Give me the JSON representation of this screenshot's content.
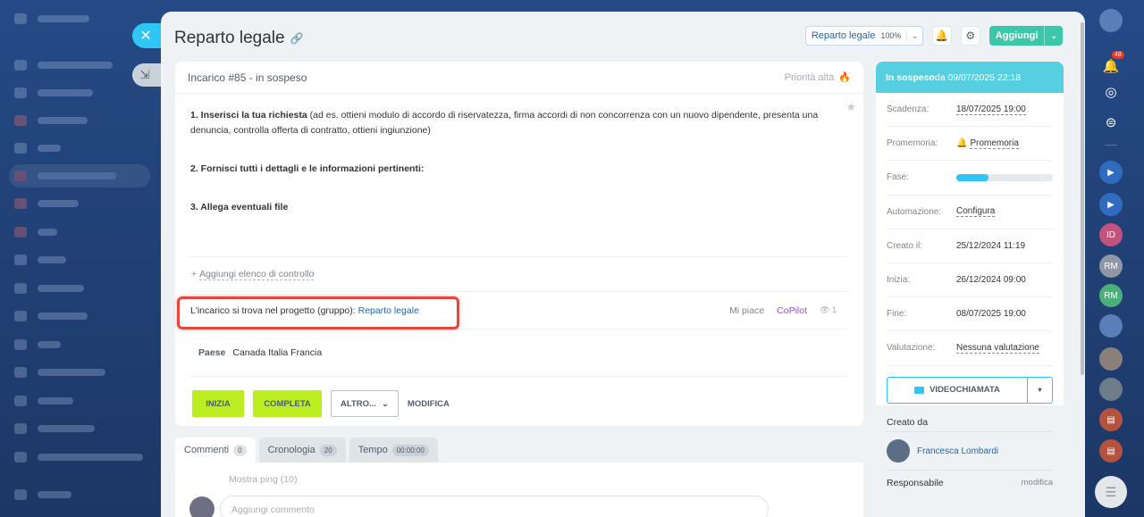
{
  "header": {
    "title": "Reparto legale",
    "project_label": "Reparto legale",
    "project_pct": "100%",
    "add_label": "Aggiungi"
  },
  "task": {
    "heading": "Incarico #85 - in sospeso",
    "priority": "Priorità alta",
    "desc": {
      "p1_bold": "1. Inserisci la tua richiesta",
      "p1_text": " (ad es. ottieni modulo di accordo di riservatezza, firma accordi di non concorrenza con un nuovo dipendente, presenta una denuncia, controlla offerta di contratto, ottieni ingiunzione)",
      "p2": "2. Fornisci tutti i dettagli e le informazioni pertinenti:",
      "p3": "3. Allega eventuali file"
    },
    "checklist": "Aggiungi elenco di controllo",
    "project_text": "L'incarico si trova nel progetto (gruppo):",
    "project_link": "Reparto legale",
    "like": "Mi piace",
    "copilot": "CoPilot",
    "views": "1",
    "country_key": "Paese",
    "country_val": "Canada Italia Francia",
    "buttons": {
      "start": "INIZIA",
      "complete": "COMPLETA",
      "more": "ALTRO...",
      "edit": "MODIFICA"
    }
  },
  "tabs": [
    {
      "label": "Commenti",
      "count": "0"
    },
    {
      "label": "Cronologia",
      "count": "20"
    },
    {
      "label": "Tempo",
      "count": "00:00:00"
    }
  ],
  "comments": {
    "ping": "Mostra ping (10)",
    "placeholder": "Aggiungi commento"
  },
  "sidebar": {
    "status_bold": "In sospeso",
    "status_rest": " da 09/07/2025 22:18",
    "rows": [
      {
        "k": "Scadenza:",
        "v": "18/07/2025 19:00"
      },
      {
        "k": "Promemoria:",
        "v": "Promemoria"
      },
      {
        "k": "Fase:",
        "v": ""
      },
      {
        "k": "Automazione:",
        "v": "Configura"
      },
      {
        "k": "Creato il:",
        "v": "25/12/2024 11:19"
      },
      {
        "k": "Inizia:",
        "v": "26/12/2024 09:00"
      },
      {
        "k": "Fine:",
        "v": "08/07/2025 19:00"
      },
      {
        "k": "Valutazione:",
        "v": "Nessuna valutazione"
      }
    ],
    "phase_progress": 0.33,
    "video_label": "VIDEOCHIAMATA",
    "created_by_label": "Creato da",
    "creator_name": "Francesca Lombardi",
    "responsible_label": "Responsabile",
    "responsible_edit": "modifica"
  },
  "right_bar": {
    "notif_count": "48",
    "id_initials": "ID",
    "rm1": "RM",
    "rm2": "RM"
  }
}
